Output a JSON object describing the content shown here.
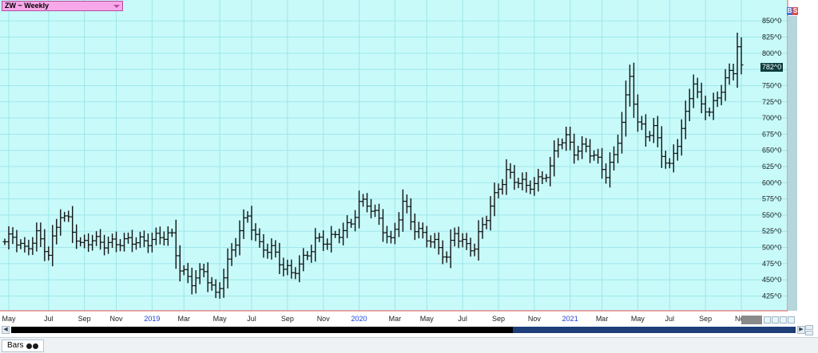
{
  "header": {
    "symbol_label": "ZW ~ Weekly"
  },
  "badges": {
    "b": "B",
    "s": "S"
  },
  "last_price_label": "782^0",
  "tab": {
    "label": "Bars"
  },
  "colors": {
    "plot_bg": "#c8fafa",
    "grid": "#9fe6ea",
    "bar": "#111111",
    "axis_line": "#e05050",
    "year_label": "#1f3fd6"
  },
  "chart_data": {
    "type": "ohlc",
    "title": "ZW ~ Weekly",
    "xlabel": "",
    "ylabel": "",
    "ylim": [
      412,
      870
    ],
    "yticks": [
      425,
      450,
      475,
      500,
      525,
      550,
      575,
      600,
      625,
      650,
      675,
      700,
      725,
      750,
      775,
      800,
      825,
      850
    ],
    "ytick_labels": [
      "425^0",
      "450^0",
      "475^0",
      "500^0",
      "525^0",
      "550^0",
      "575^0",
      "600^0",
      "625^0",
      "650^0",
      "675^0",
      "700^0",
      "725^0",
      "750^0",
      "775^0",
      "800^0",
      "825^0",
      "850^0"
    ],
    "grid": true,
    "axis_side": "right",
    "bar_count": 186,
    "xticks": [
      {
        "label": "May",
        "index": 1,
        "year": false
      },
      {
        "label": "Jul",
        "index": 11,
        "year": false
      },
      {
        "label": "Sep",
        "index": 20,
        "year": false
      },
      {
        "label": "Nov",
        "index": 28,
        "year": false
      },
      {
        "label": "2019",
        "index": 37,
        "year": true
      },
      {
        "label": "Mar",
        "index": 45,
        "year": false
      },
      {
        "label": "May",
        "index": 54,
        "year": false
      },
      {
        "label": "Jul",
        "index": 62,
        "year": false
      },
      {
        "label": "Sep",
        "index": 71,
        "year": false
      },
      {
        "label": "Nov",
        "index": 80,
        "year": false
      },
      {
        "label": "2020",
        "index": 89,
        "year": true
      },
      {
        "label": "Mar",
        "index": 98,
        "year": false
      },
      {
        "label": "May",
        "index": 106,
        "year": false
      },
      {
        "label": "Jul",
        "index": 115,
        "year": false
      },
      {
        "label": "Sep",
        "index": 124,
        "year": false
      },
      {
        "label": "Nov",
        "index": 133,
        "year": false
      },
      {
        "label": "2021",
        "index": 142,
        "year": true
      },
      {
        "label": "Mar",
        "index": 150,
        "year": false
      },
      {
        "label": "May",
        "index": 159,
        "year": false
      },
      {
        "label": "Jul",
        "index": 167,
        "year": false
      },
      {
        "label": "Sep",
        "index": 176,
        "year": false
      },
      {
        "label": "Nov",
        "index": 185,
        "year": false
      }
    ],
    "anchors": [
      [
        0,
        505
      ],
      [
        2,
        515
      ],
      [
        5,
        500
      ],
      [
        8,
        520
      ],
      [
        11,
        485
      ],
      [
        14,
        555
      ],
      [
        16,
        545
      ],
      [
        19,
        500
      ],
      [
        22,
        510
      ],
      [
        26,
        510
      ],
      [
        30,
        505
      ],
      [
        34,
        512
      ],
      [
        38,
        515
      ],
      [
        42,
        515
      ],
      [
        44,
        470
      ],
      [
        47,
        450
      ],
      [
        50,
        460
      ],
      [
        53,
        425
      ],
      [
        56,
        480
      ],
      [
        59,
        525
      ],
      [
        61,
        545
      ],
      [
        64,
        505
      ],
      [
        67,
        500
      ],
      [
        70,
        465
      ],
      [
        72,
        458
      ],
      [
        75,
        485
      ],
      [
        78,
        510
      ],
      [
        81,
        505
      ],
      [
        84,
        525
      ],
      [
        87,
        540
      ],
      [
        89,
        565
      ],
      [
        91,
        565
      ],
      [
        94,
        545
      ],
      [
        97,
        510
      ],
      [
        100,
        565
      ],
      [
        103,
        530
      ],
      [
        106,
        520
      ],
      [
        108,
        505
      ],
      [
        111,
        480
      ],
      [
        113,
        525
      ],
      [
        116,
        505
      ],
      [
        118,
        500
      ],
      [
        121,
        545
      ],
      [
        124,
        595
      ],
      [
        126,
        620
      ],
      [
        128,
        605
      ],
      [
        131,
        590
      ],
      [
        134,
        605
      ],
      [
        137,
        625
      ],
      [
        139,
        660
      ],
      [
        141,
        665
      ],
      [
        143,
        650
      ],
      [
        146,
        660
      ],
      [
        149,
        630
      ],
      [
        151,
        610
      ],
      [
        153,
        640
      ],
      [
        155,
        700
      ],
      [
        157,
        765
      ],
      [
        159,
        690
      ],
      [
        161,
        670
      ],
      [
        163,
        685
      ],
      [
        165,
        650
      ],
      [
        167,
        625
      ],
      [
        169,
        660
      ],
      [
        171,
        700
      ],
      [
        173,
        760
      ],
      [
        175,
        720
      ],
      [
        177,
        715
      ],
      [
        179,
        725
      ],
      [
        181,
        760
      ],
      [
        183,
        770
      ],
      [
        184,
        820
      ],
      [
        186,
        840
      ],
      [
        188,
        785
      ]
    ],
    "last_value": 782
  }
}
